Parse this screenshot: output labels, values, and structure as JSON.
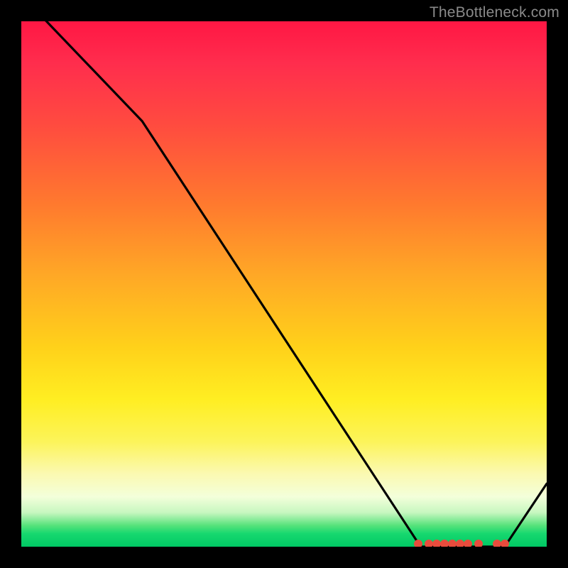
{
  "attribution": "TheBottleneck.com",
  "chart_data": {
    "type": "line",
    "title": "",
    "xlabel": "",
    "ylabel": "",
    "xlim": [
      0,
      100
    ],
    "ylim": [
      0,
      100
    ],
    "x": [
      0,
      23,
      76,
      92,
      100
    ],
    "values": [
      105,
      81,
      0,
      0,
      12
    ],
    "markers": [
      {
        "x": 75.5,
        "y": 0.5
      },
      {
        "x": 77.5,
        "y": 0.5
      },
      {
        "x": 79.0,
        "y": 0.5
      },
      {
        "x": 80.5,
        "y": 0.5
      },
      {
        "x": 82.0,
        "y": 0.5
      },
      {
        "x": 83.5,
        "y": 0.5
      },
      {
        "x": 85.0,
        "y": 0.5
      },
      {
        "x": 87.0,
        "y": 0.5
      },
      {
        "x": 90.5,
        "y": 0.5
      },
      {
        "x": 92.0,
        "y": 0.5
      }
    ],
    "notes": "Gradient background runs red (top, high y) to green (bottom, low y). Black line descends steeply with a slope change near x≈23, reaches y=0 on a flat segment ~x=76–92 where red circular markers lie, then rises toward x=100."
  }
}
